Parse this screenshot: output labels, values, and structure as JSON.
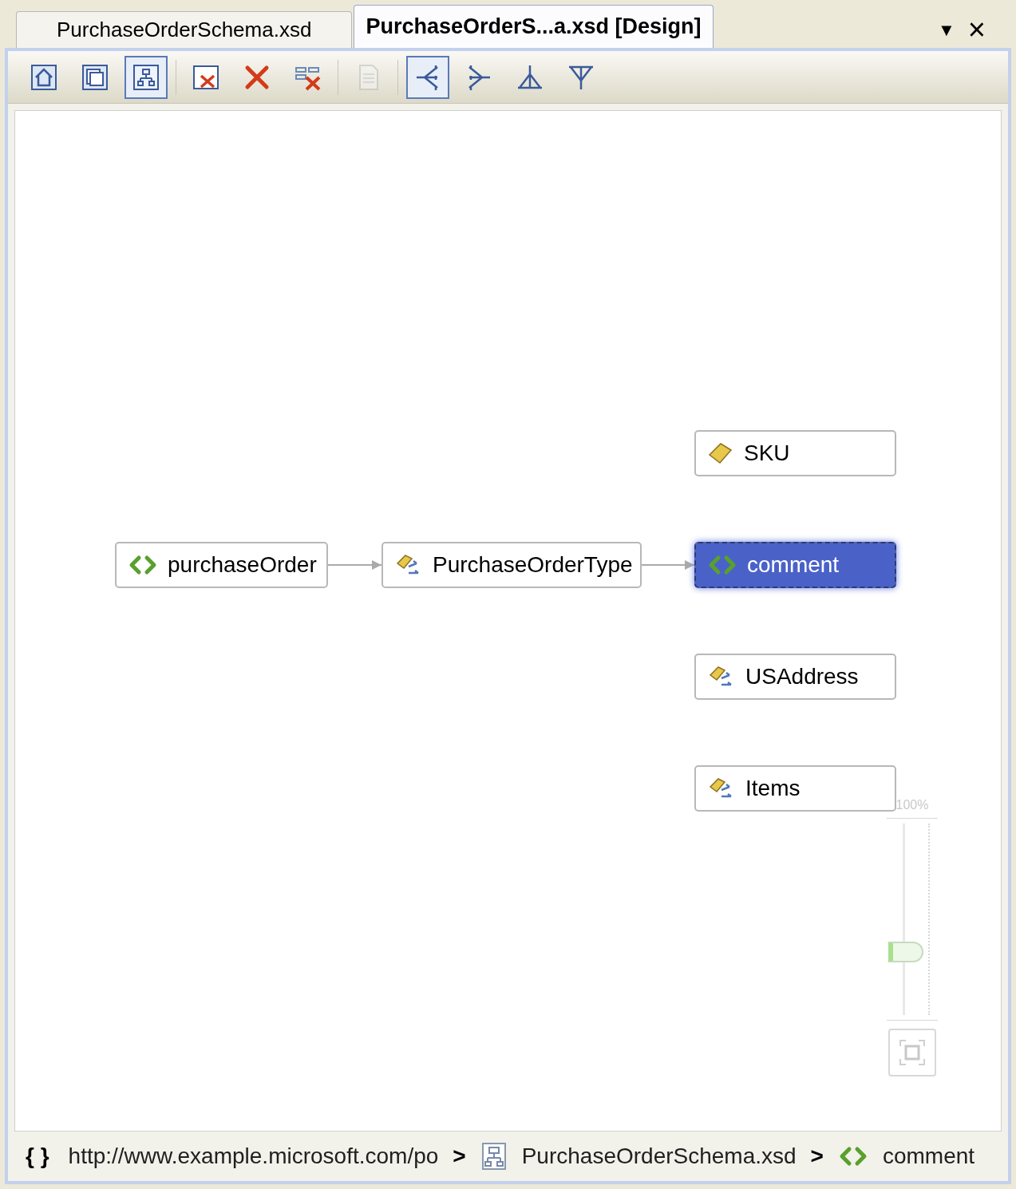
{
  "tabs": [
    {
      "label": "PurchaseOrderSchema.xsd",
      "selected": false
    },
    {
      "label": "PurchaseOrderS...a.xsd [Design]",
      "selected": true
    }
  ],
  "window_controls": {
    "dropdown": "▼",
    "close": "×"
  },
  "toolbar": [
    {
      "kind": "home",
      "selected": false,
      "disabled": false
    },
    {
      "kind": "pages",
      "selected": false,
      "disabled": false
    },
    {
      "kind": "diagram",
      "selected": true,
      "disabled": false
    },
    {
      "kind": "close-view",
      "selected": false,
      "disabled": false
    },
    {
      "kind": "delete",
      "selected": false,
      "disabled": false
    },
    {
      "kind": "delete-all",
      "selected": false,
      "disabled": false
    },
    {
      "kind": "document",
      "selected": false,
      "disabled": true
    },
    {
      "kind": "tree-left",
      "selected": true,
      "disabled": false
    },
    {
      "kind": "tree-right",
      "selected": false,
      "disabled": false
    },
    {
      "kind": "tree-up",
      "selected": false,
      "disabled": false
    },
    {
      "kind": "tree-down",
      "selected": false,
      "disabled": false
    }
  ],
  "diagram": {
    "nodes": [
      {
        "label": "purchaseOrder",
        "kind": "element",
        "selected": false
      },
      {
        "label": "PurchaseOrderType",
        "kind": "complex-type",
        "selected": false
      },
      {
        "label": "SKU",
        "kind": "attribute",
        "selected": false
      },
      {
        "label": "comment",
        "kind": "element",
        "selected": true
      },
      {
        "label": "USAddress",
        "kind": "complex-type",
        "selected": false
      },
      {
        "label": "Items",
        "kind": "complex-type",
        "selected": false
      }
    ],
    "zoom": {
      "label": "100%",
      "level": 0.33
    }
  },
  "breadcrumb": {
    "namespace_icon": "{ }",
    "items": [
      {
        "label": "http://www.example.microsoft.com/po",
        "kind": "namespace"
      },
      {
        "label": "PurchaseOrderSchema.xsd",
        "kind": "schema"
      },
      {
        "label": "comment",
        "kind": "element"
      }
    ],
    "separator": ">"
  }
}
